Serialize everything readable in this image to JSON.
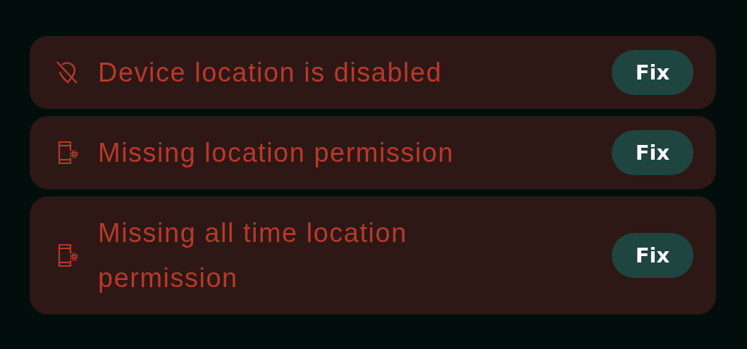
{
  "issues": [
    {
      "kind": "location-off",
      "message": "Device location is disabled",
      "button": "Fix"
    },
    {
      "kind": "phone-settings",
      "message": "Missing location permission",
      "button": "Fix"
    },
    {
      "kind": "phone-settings",
      "message": "Missing all time location permission",
      "button": "Fix"
    }
  ]
}
